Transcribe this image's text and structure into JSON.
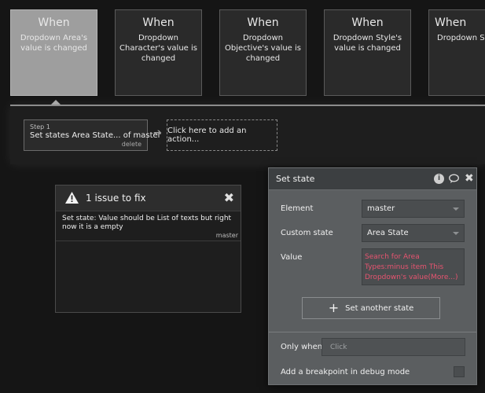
{
  "events": [
    {
      "when": "When",
      "desc": "Dropdown Area's value is changed",
      "selected": true
    },
    {
      "when": "When",
      "desc": "Dropdown Character's value is changed",
      "selected": false
    },
    {
      "when": "When",
      "desc": "Dropdown Objective's value is changed",
      "selected": false
    },
    {
      "when": "When",
      "desc": "Dropdown Style's value is changed",
      "selected": false
    },
    {
      "when": "When",
      "desc": "Dropdown Subj... value is cha...",
      "selected": false
    }
  ],
  "workflow": {
    "step_label": "Step 1",
    "step_title": "Set states Area State... of master",
    "step_delete": "delete",
    "add_action": "Click here to add an action..."
  },
  "issues": {
    "title": "1 issue to fix",
    "items": [
      {
        "text": "Set state: Value should be List of texts but right now it is a empty",
        "source": "master"
      }
    ]
  },
  "set_state": {
    "title": "Set state",
    "element_label": "Element",
    "element_value": "master",
    "custom_state_label": "Custom state",
    "custom_state_value": "Area State",
    "value_label": "Value",
    "value_expression": "Search for Area Types:minus item This Dropdown's value(More...)",
    "another_state_button": "Set another state",
    "only_when_label": "Only when",
    "only_when_placeholder": "Click",
    "breakpoint_label": "Add a breakpoint in debug mode"
  },
  "colors": {
    "expression": "#e75470",
    "selected_event": "#9e9e9e",
    "panel_bg": "#5b5e60"
  }
}
